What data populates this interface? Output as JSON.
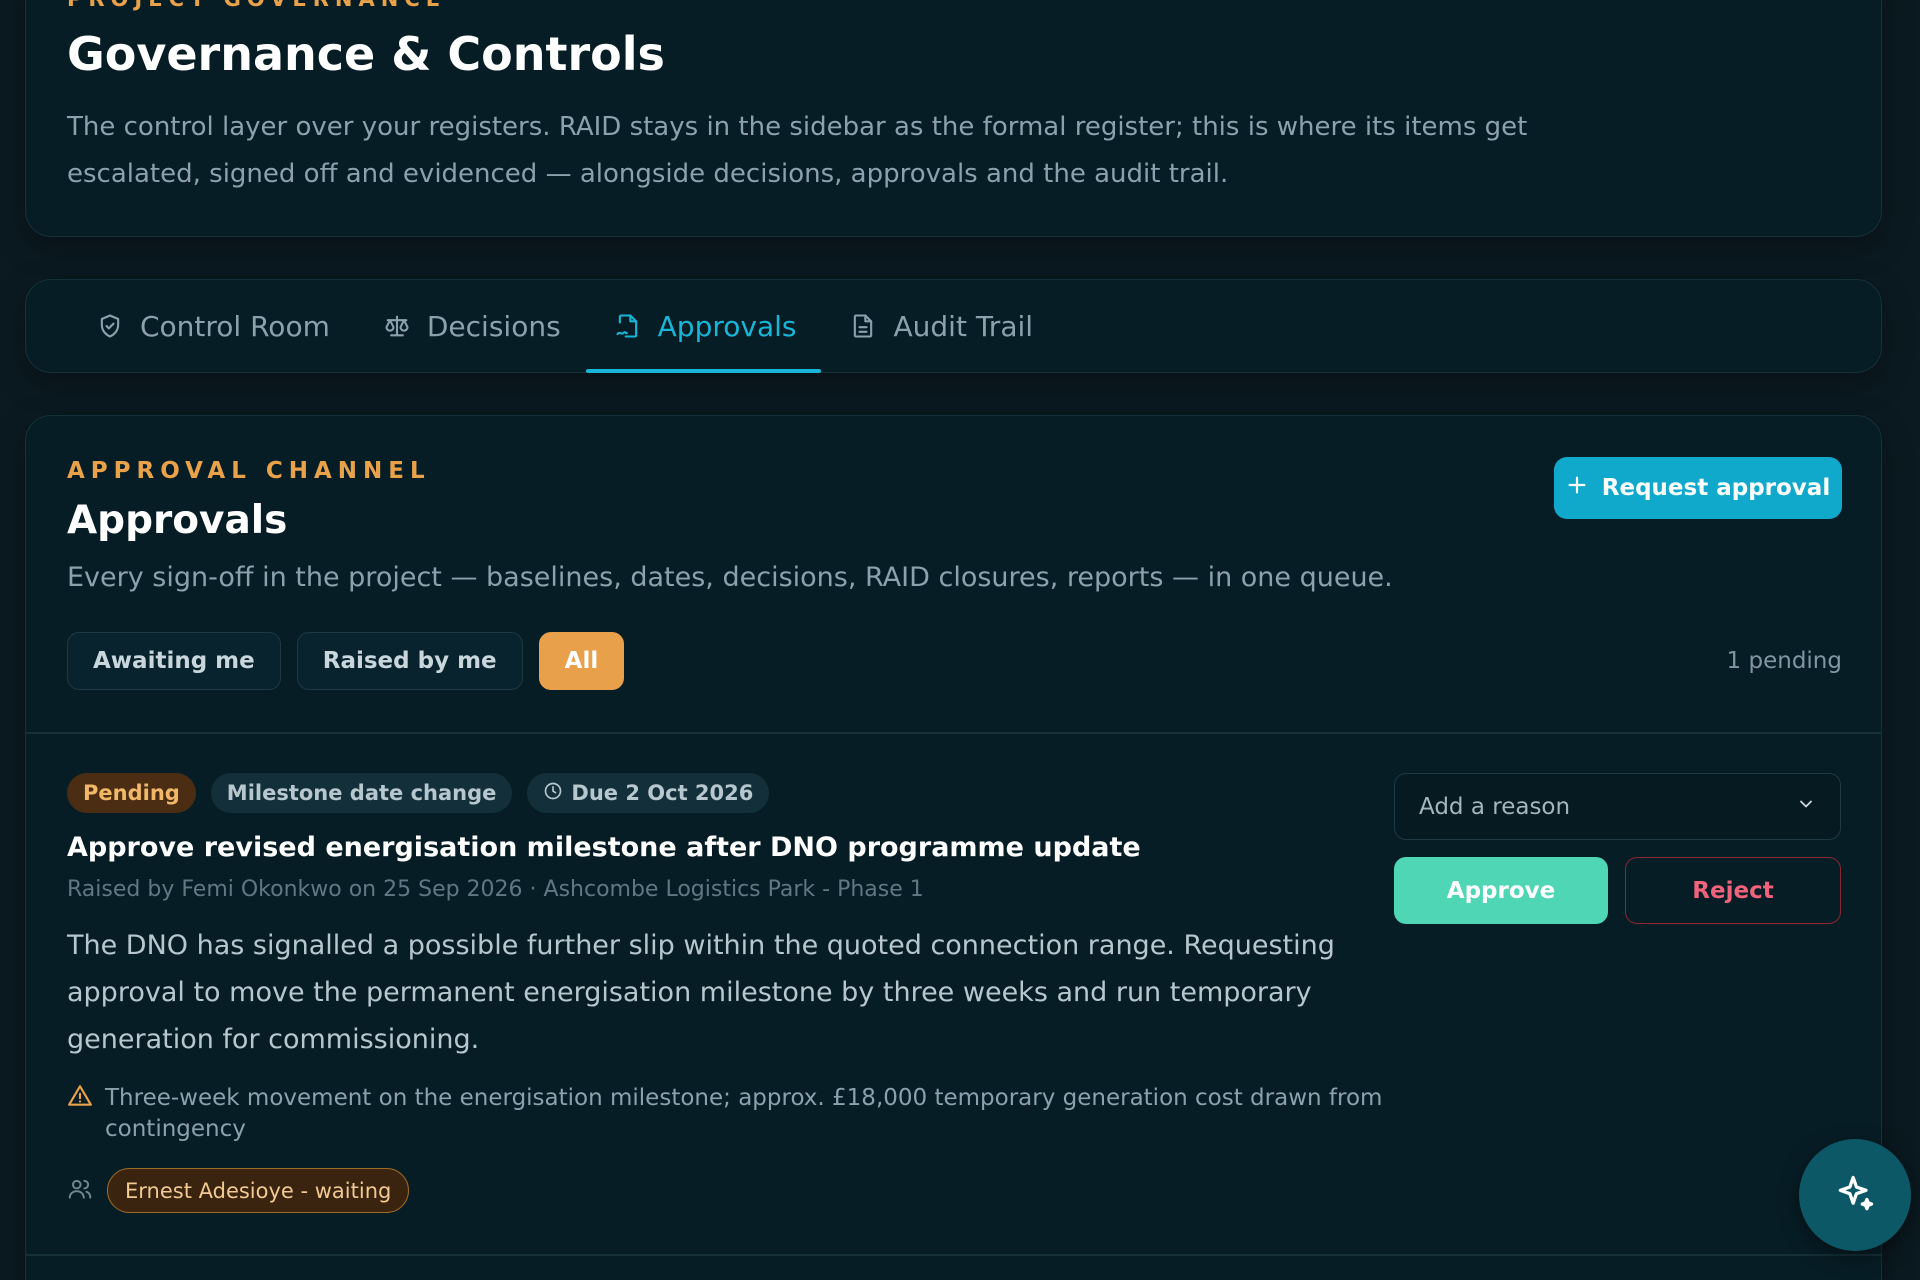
{
  "header": {
    "eyebrow": "PROJECT GOVERNANCE",
    "title": "Governance & Controls",
    "description": "The control layer over your registers. RAID stays in the sidebar as the formal register; this is where its items get escalated, signed off and evidenced — alongside decisions, approvals and the audit trail."
  },
  "tabs": [
    {
      "label": "Control Room",
      "icon": "shield-check-icon"
    },
    {
      "label": "Decisions",
      "icon": "scales-icon"
    },
    {
      "label": "Approvals",
      "icon": "file-signature-icon",
      "active": true
    },
    {
      "label": "Audit Trail",
      "icon": "document-icon"
    }
  ],
  "approvals": {
    "eyebrow": "APPROVAL CHANNEL",
    "title": "Approvals",
    "subtitle": "Every sign-off in the project — baselines, dates, decisions, RAID closures, reports — in one queue.",
    "request_button": "Request approval",
    "filters": [
      {
        "label": "Awaiting me"
      },
      {
        "label": "Raised by me"
      },
      {
        "label": "All",
        "active": true
      }
    ],
    "pending_count": "1 pending",
    "item": {
      "status": "Pending",
      "type": "Milestone date change",
      "due": "Due 2 Oct 2026",
      "title": "Approve revised energisation milestone after DNO programme update",
      "meta": "Raised by Femi Okonkwo on 25 Sep 2026 · Ashcombe Logistics Park - Phase 1",
      "description": "The DNO has signalled a possible further slip within the quoted connection range. Requesting approval to move the permanent energisation milestone by three weeks and run temporary generation for commissioning.",
      "impact": "Three-week movement on the energisation milestone; approx. £18,000 temporary generation cost drawn from contingency",
      "approver": "Ernest Adesioye - waiting",
      "reason_placeholder": "Add a reason",
      "approve_label": "Approve",
      "reject_label": "Reject"
    }
  },
  "colors": {
    "accent": "#18b6d6",
    "eyebrow": "#e9a24a",
    "approve": "#4fd6b5",
    "reject": "#f0637a",
    "background": "#071d26"
  }
}
